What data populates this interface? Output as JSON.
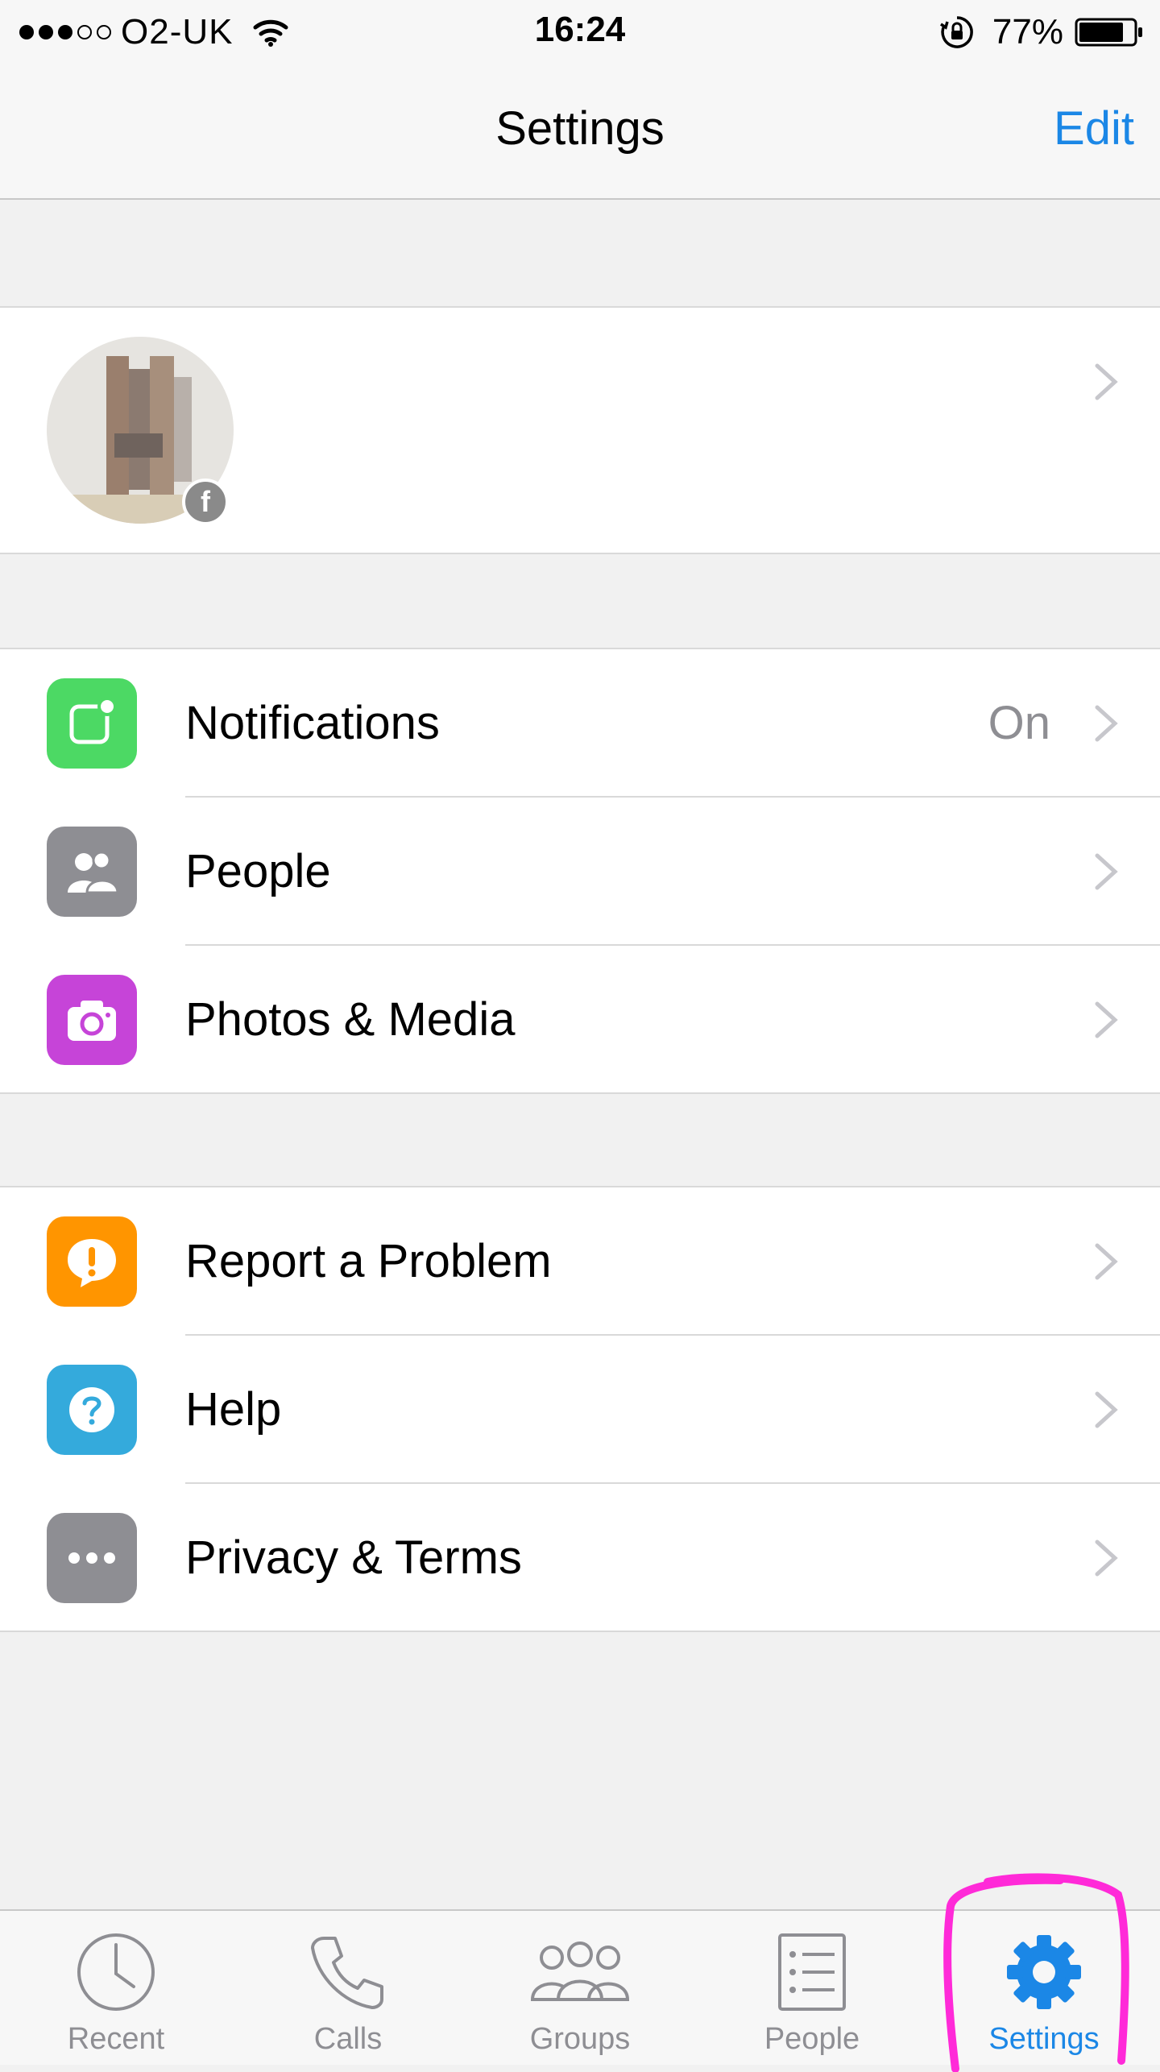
{
  "status_bar": {
    "carrier": "O2-UK",
    "time": "16:24",
    "battery": "77%"
  },
  "nav": {
    "title": "Settings",
    "edit_label": "Edit"
  },
  "profile": {
    "avatar_icon": "profile-avatar",
    "badge_icon": "facebook-badge-icon"
  },
  "section1": [
    {
      "label": "Notifications",
      "value": "On",
      "icon": "notifications-icon",
      "color": "#4cd964"
    },
    {
      "label": "People",
      "value": "",
      "icon": "people-icon",
      "color": "#8e8e93"
    },
    {
      "label": "Photos & Media",
      "value": "",
      "icon": "camera-icon",
      "color": "#c644d8"
    }
  ],
  "section2": [
    {
      "label": "Report a Problem",
      "icon": "alert-icon",
      "color": "#ff9500"
    },
    {
      "label": "Help",
      "icon": "help-icon",
      "color": "#34aadc"
    },
    {
      "label": "Privacy & Terms",
      "icon": "more-icon",
      "color": "#8e8e93"
    }
  ],
  "tabs": [
    {
      "label": "Recent",
      "icon": "clock-icon"
    },
    {
      "label": "Calls",
      "icon": "phone-icon"
    },
    {
      "label": "Groups",
      "icon": "groups-icon"
    },
    {
      "label": "People",
      "icon": "contacts-list-icon"
    },
    {
      "label": "Settings",
      "icon": "gear-icon",
      "active": true
    }
  ],
  "colors": {
    "accent": "#1b87e6",
    "highlight": "#ff2ad8"
  }
}
